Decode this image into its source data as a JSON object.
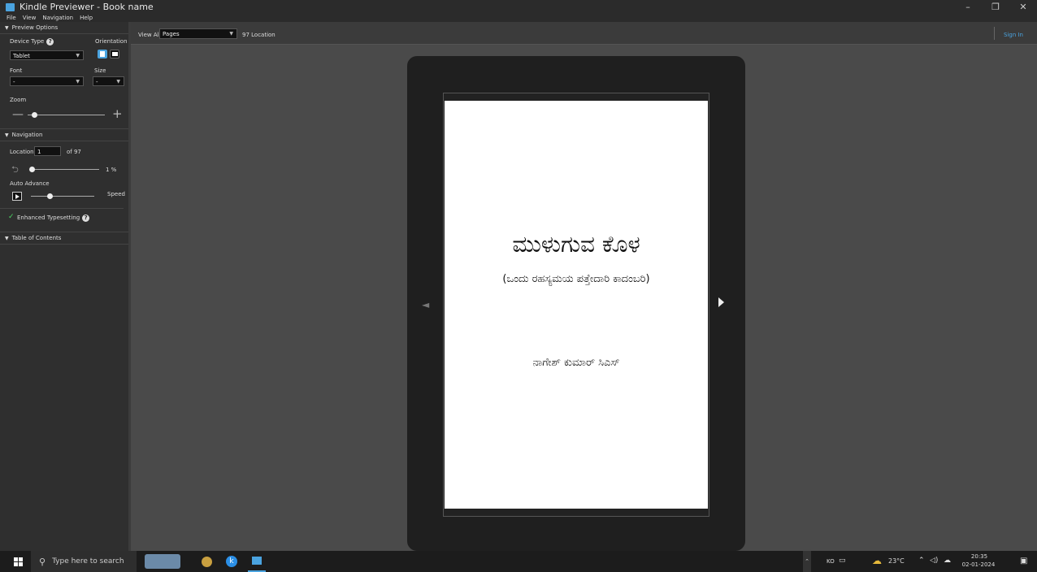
{
  "window": {
    "title": "Kindle Previewer - Book name",
    "controls": [
      "–",
      "❐",
      "✕"
    ]
  },
  "menu": {
    "file": "File",
    "view": "View",
    "navigation": "Navigation",
    "help": "Help"
  },
  "preview_options": {
    "header": "Preview Options",
    "device_type_label": "Device Type",
    "device_type_value": "Tablet",
    "orientation_label": "Orientation",
    "font_label": "Font",
    "font_value": "-",
    "size_label": "Size",
    "size_value": "-",
    "zoom_label": "Zoom",
    "zoom_minus": "—",
    "zoom_plus": "+",
    "zoom_level": 0.08
  },
  "navigation": {
    "header": "Navigation",
    "location_label": "Location",
    "location_value": "1",
    "of_total": "of 97",
    "progress_percent": "1 %",
    "progress_level": 0.01,
    "auto_advance_label": "Auto Advance",
    "speed_label": "Speed",
    "speed_level": 0.3
  },
  "enhanced_typesetting": {
    "check": "✓",
    "label": "Enhanced Typesetting"
  },
  "toc": {
    "header": "Table of Contents"
  },
  "toolbar": {
    "view_all_label": "View All",
    "view_mode": "Pages",
    "location_count": "97 Location",
    "sign_in": "Sign In"
  },
  "page": {
    "title": "ಮುಳುಗುವ ಕೊಳ",
    "subtitle": "(ಒಂದು ರಹಸ್ಯಮಯ ಪತ್ತೇದಾರಿ ಕಾದಂಬರಿ)",
    "author": "ನಾಗೇಶ್ ಕುಮಾರ್ ಸಿಎಸ್"
  },
  "taskbar": {
    "search_placeholder": "Type here to search",
    "input_indicator": "KO",
    "temperature": "23°C",
    "time": "20:35",
    "date": "02-01-2024"
  },
  "colors": {
    "accent": "#4aa3df",
    "check": "#4cd964",
    "sidebar": "#2f2f2f",
    "canvas": "#4a4a4a"
  }
}
